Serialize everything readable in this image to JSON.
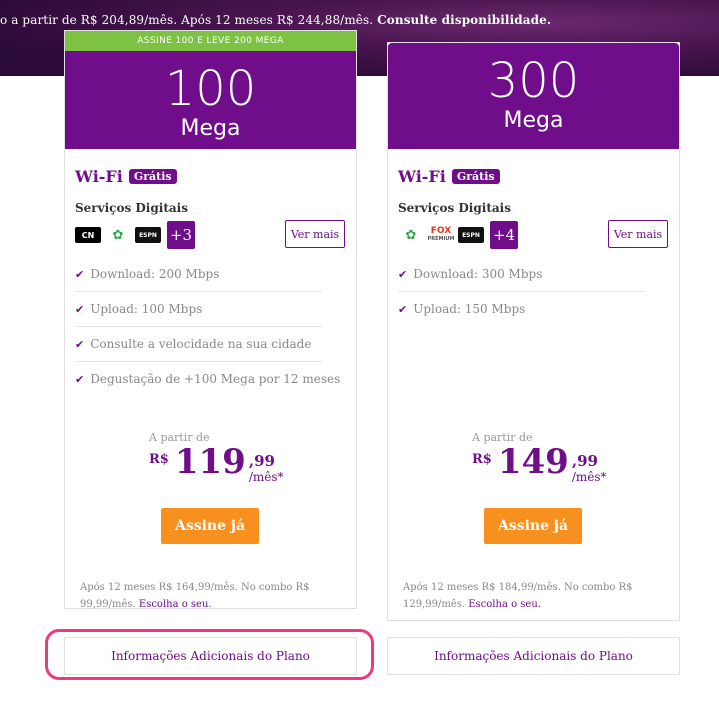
{
  "banner": {
    "text_prefix": "o a partir de R$ 204,89/mês. Após 12 meses R$ 244,88/mês. ",
    "text_bold": "Consulte disponibilidade."
  },
  "plans": [
    {
      "promo": "ASSINE 100 E LEVE 200 MEGA",
      "speed": "100",
      "unit": "Mega",
      "wifi": "Wi-Fi",
      "wifi_badge": "Grátis",
      "services_title": "Serviços Digitais",
      "logos": [
        "cartoon-network-logo",
        "discovery-kids-logo",
        "watch-espn-logo"
      ],
      "more_count": "+3",
      "ver_mais": "Ver mais",
      "features": [
        "Download: 200 Mbps",
        "Upload: 100 Mbps",
        "Consulte a velocidade na sua cidade",
        "Degustação de +100 Mega por 12 meses"
      ],
      "price_label": "A partir de",
      "currency": "R$",
      "price_int": "119",
      "price_cents": ",99",
      "price_period": "/mês*",
      "cta": "Assine já",
      "note": "Após 12 meses R$ 164,99/mês. No combo R$ 99,99/mês. ",
      "note_link": "Escolha o seu.",
      "info_button": "Informações Adicionais do Plano"
    },
    {
      "promo": "",
      "speed": "300",
      "unit": "Mega",
      "wifi": "Wi-Fi",
      "wifi_badge": "Grátis",
      "services_title": "Serviços Digitais",
      "logos": [
        "discovery-kids-logo",
        "fox-premium-logo",
        "watch-espn-logo"
      ],
      "more_count": "+4",
      "ver_mais": "Ver mais",
      "features": [
        "Download: 300 Mbps",
        "Upload: 150 Mbps"
      ],
      "price_label": "A partir de",
      "currency": "R$",
      "price_int": "149",
      "price_cents": ",99",
      "price_period": "/mês*",
      "cta": "Assine já",
      "note": "Após 12 meses R$ 184,99/mês. No combo R$ 129,99/mês. ",
      "note_link": "Escolha o seu.",
      "info_button": "Informações Adicionais do Plano"
    }
  ],
  "logo_text": {
    "cn": "CN",
    "dk": "✿",
    "espn": "ESPN",
    "fox": "FOX",
    "fox_sub": "PREMIUM"
  },
  "colors": {
    "brand_purple": "#6f0d8a",
    "promo_green": "#7dc242",
    "cta_orange": "#f7901e",
    "highlight_pink": "#ea3b7e"
  }
}
